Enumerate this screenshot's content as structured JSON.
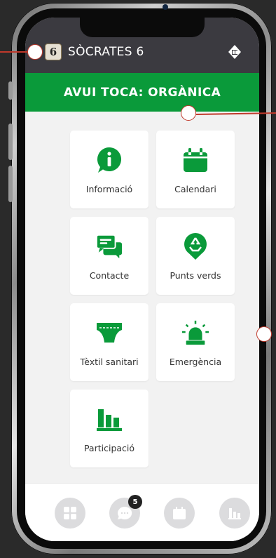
{
  "header": {
    "title": "SÒCRATES 6",
    "logo_text": "6"
  },
  "banner": {
    "text": "AVUI TOCA: ORGÀNICA"
  },
  "tiles": [
    {
      "label": "Informació",
      "icon": "info-icon"
    },
    {
      "label": "Calendari",
      "icon": "calendar-icon"
    },
    {
      "label": "Contacte",
      "icon": "chat-icon"
    },
    {
      "label": "Punts verds",
      "icon": "recycle-pin-icon"
    },
    {
      "label": "Tèxtil sanitari",
      "icon": "diaper-icon"
    },
    {
      "label": "Emergència",
      "icon": "siren-icon"
    },
    {
      "label": "Participació",
      "icon": "bar-chart-icon"
    }
  ],
  "bottom_nav": {
    "items": [
      "grid-icon",
      "chat-icon",
      "calendar-icon",
      "bar-chart-icon"
    ],
    "badge": "5"
  },
  "colors": {
    "accent": "#0a9a3a",
    "header": "#3b3a40",
    "marker": "#c0392b"
  }
}
